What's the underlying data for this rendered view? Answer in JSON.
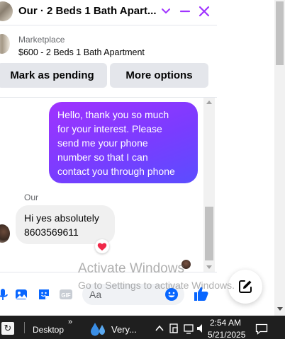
{
  "header": {
    "title": "Our · 2 Beds 1 Bath Apart..."
  },
  "listing": {
    "label": "Marketplace",
    "title": "$600 - 2 Beds 1 Bath Apartment"
  },
  "actions": {
    "pending_label": "Mark as pending",
    "more_label": "More options"
  },
  "messages": {
    "outgoing_lines": [
      "Hello, thank you so much",
      "for your interest. Please",
      "send me your phone",
      "number so that I can",
      "contact you through phone"
    ],
    "sender_name": "Our",
    "incoming_lines": [
      "Hi yes absolutely",
      "8603569611"
    ],
    "reaction": "heart"
  },
  "composer": {
    "placeholder": "Aa"
  },
  "watermark": {
    "title": "Activate Windows",
    "subtitle": "Go to Settings to activate Windows."
  },
  "taskbar": {
    "desktop_label": "Desktop",
    "chevron": "»",
    "weather_label": "Very...",
    "time": "2:54 AM",
    "date": "5/21/2025"
  },
  "colors": {
    "accent": "#0866ff",
    "bubble_start": "#a033ff",
    "bubble_end": "#5b4dff",
    "close": "#a033ff"
  },
  "icons": [
    "chevron-down-icon",
    "minimize-icon",
    "close-icon",
    "mic-icon",
    "image-icon",
    "sticker-icon",
    "gif-icon",
    "emoji-icon",
    "like-icon",
    "new-message-icon",
    "heart-icon"
  ]
}
